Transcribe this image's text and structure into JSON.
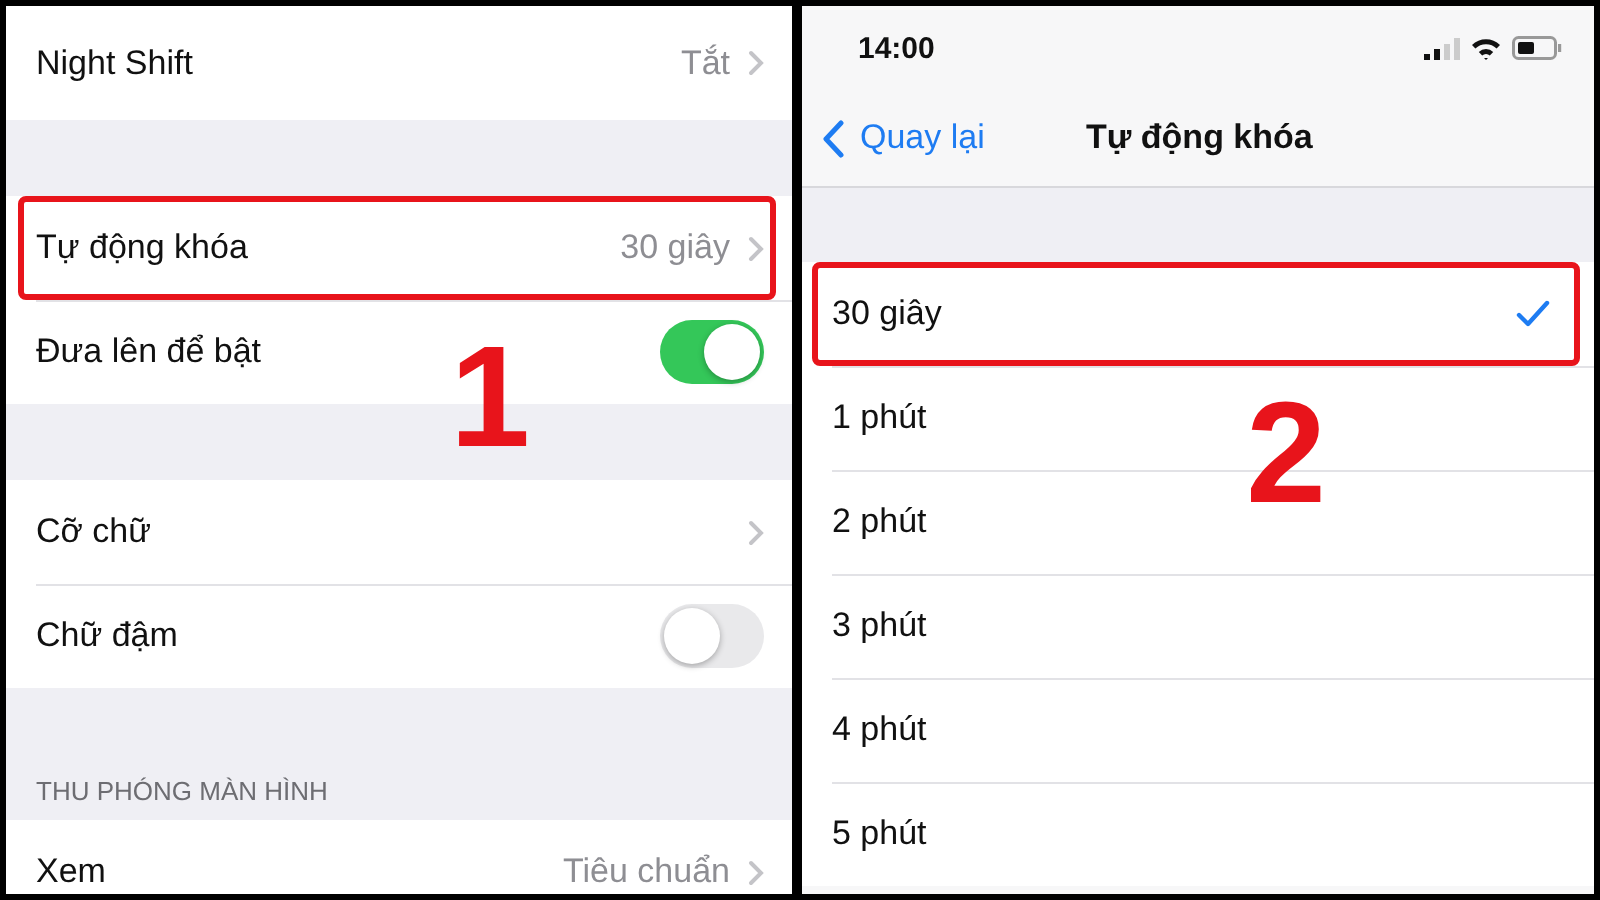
{
  "left_screen": {
    "groups": [
      {
        "rows": [
          {
            "label": "Night Shift",
            "kind": "link",
            "value": "Tắt",
            "highlighted": false
          }
        ]
      },
      {
        "rows": [
          {
            "label": "Tự động khóa",
            "kind": "link",
            "value": "30 giây",
            "highlighted": true
          },
          {
            "label": "Đưa lên để bật",
            "kind": "toggle",
            "on": true,
            "highlighted": false
          }
        ]
      },
      {
        "rows": [
          {
            "label": "Cỡ chữ",
            "kind": "link",
            "highlighted": false
          },
          {
            "label": "Chữ đậm",
            "kind": "toggle",
            "on": false,
            "highlighted": false
          }
        ]
      },
      {
        "header": "THU PHÓNG MÀN HÌNH",
        "rows": [
          {
            "label": "Xem",
            "kind": "link",
            "value": "Tiêu chuẩn",
            "highlighted": false
          }
        ]
      }
    ],
    "step_number": "1"
  },
  "right_screen": {
    "status_bar": {
      "time": "14:00"
    },
    "nav_bar": {
      "back": "Quay lại",
      "title": "Tự động khóa"
    },
    "options": [
      {
        "label": "30 giây",
        "selected": true,
        "highlighted": true
      },
      {
        "label": "1 phút",
        "selected": false,
        "highlighted": false
      },
      {
        "label": "2 phút",
        "selected": false,
        "highlighted": false
      },
      {
        "label": "3 phút",
        "selected": false,
        "highlighted": false
      },
      {
        "label": "4 phút",
        "selected": false,
        "highlighted": false
      },
      {
        "label": "5 phút",
        "selected": false,
        "highlighted": false
      }
    ],
    "step_number": "2"
  }
}
